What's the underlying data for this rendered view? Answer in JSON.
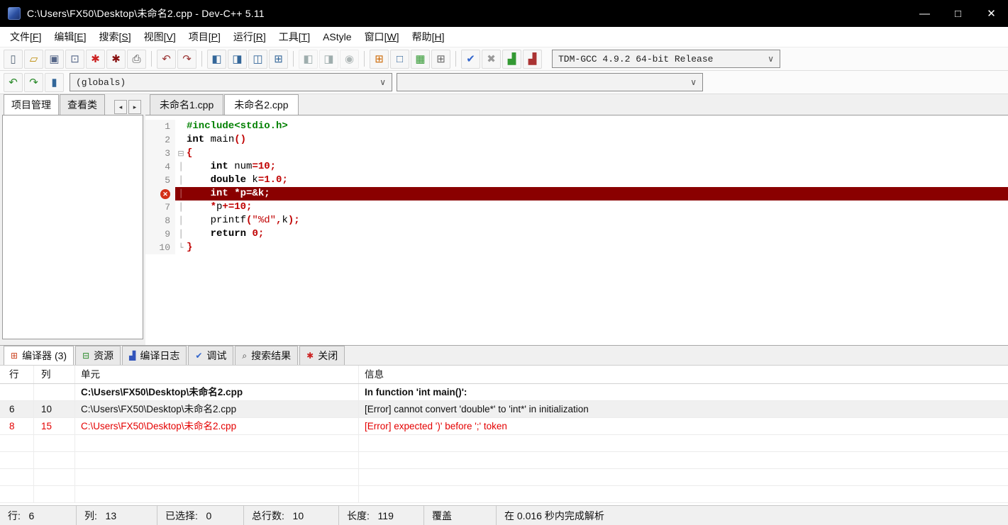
{
  "window": {
    "title": "C:\\Users\\FX50\\Desktop\\未命名2.cpp - Dev-C++ 5.11",
    "controls": {
      "minimize": "—",
      "maximize": "□",
      "close": "✕"
    }
  },
  "menu": {
    "items": [
      {
        "id": "file",
        "text": "文件",
        "key": "F"
      },
      {
        "id": "edit",
        "text": "编辑",
        "key": "E"
      },
      {
        "id": "search",
        "text": "搜索",
        "key": "S"
      },
      {
        "id": "view",
        "text": "视图",
        "key": "V"
      },
      {
        "id": "project",
        "text": "项目",
        "key": "P"
      },
      {
        "id": "run",
        "text": "运行",
        "key": "R"
      },
      {
        "id": "tools",
        "text": "工具",
        "key": "T"
      },
      {
        "id": "astyle",
        "text": "AStyle",
        "key": ""
      },
      {
        "id": "window",
        "text": "窗口",
        "key": "W"
      },
      {
        "id": "help",
        "text": "帮助",
        "key": "H"
      }
    ]
  },
  "toolbar": {
    "groups": [
      [
        {
          "name": "new-file-icon",
          "glyph": "▯",
          "color": "#556677"
        },
        {
          "name": "open-file-icon",
          "glyph": "▱",
          "color": "#bb8800"
        },
        {
          "name": "save-icon",
          "glyph": "▣",
          "color": "#556688"
        },
        {
          "name": "save-all-icon",
          "glyph": "⊡",
          "color": "#556688"
        },
        {
          "name": "close-file-icon",
          "glyph": "✱",
          "color": "#cc2222"
        },
        {
          "name": "close-all-icon",
          "glyph": "✱",
          "color": "#881111"
        },
        {
          "name": "print-icon",
          "glyph": "⎙",
          "color": "#444444"
        }
      ],
      [
        {
          "name": "undo-icon",
          "glyph": "↶",
          "color": "#993333"
        },
        {
          "name": "redo-icon",
          "glyph": "↷",
          "color": "#993333"
        }
      ],
      [
        {
          "name": "compile-icon",
          "glyph": "◧",
          "color": "#336699"
        },
        {
          "name": "run-icon",
          "glyph": "◨",
          "color": "#336699"
        },
        {
          "name": "compile-run-icon",
          "glyph": "◫",
          "color": "#336699"
        },
        {
          "name": "rebuild-all-icon",
          "glyph": "⊞",
          "color": "#336699"
        }
      ],
      [
        {
          "name": "debug-icon",
          "glyph": "◧",
          "color": "#2f4f4f",
          "disabled": true
        },
        {
          "name": "profile-icon",
          "glyph": "◨",
          "color": "#2f4f4f",
          "disabled": true
        },
        {
          "name": "stop-execution-icon",
          "glyph": "◉",
          "color": "#556666",
          "disabled": true
        }
      ],
      [
        {
          "name": "project-manager-toggle-icon",
          "glyph": "⊞",
          "color": "#cc6600"
        },
        {
          "name": "report-window-toggle-icon",
          "glyph": "□",
          "color": "#336699"
        },
        {
          "name": "window-layout-icon",
          "glyph": "▦",
          "color": "#339933"
        },
        {
          "name": "fullscreen-toggle-icon",
          "glyph": "⊞",
          "color": "#666666"
        }
      ],
      [
        {
          "name": "syntax-check-icon",
          "glyph": "✔",
          "color": "#3366cc"
        },
        {
          "name": "abort-icon",
          "glyph": "✖",
          "color": "#999999"
        },
        {
          "name": "profile-chart-icon",
          "glyph": "▟",
          "color": "#339933"
        },
        {
          "name": "delete-profiling-icon",
          "glyph": "▟",
          "color": "#aa3333"
        }
      ]
    ],
    "compiler_select": {
      "value": "TDM-GCC 4.9.2 64-bit Release"
    }
  },
  "toolbar2": {
    "buttons": [
      {
        "name": "nav-back-icon",
        "glyph": "↶",
        "color": "#2a8a2a"
      },
      {
        "name": "nav-forward-icon",
        "glyph": "↷",
        "color": "#2a8a2a"
      },
      {
        "name": "class-browser-icon",
        "glyph": "▮",
        "color": "#336699"
      }
    ],
    "globals_select": {
      "value": "(globals)"
    },
    "members_select": {
      "value": ""
    }
  },
  "left_panel": {
    "tabs": [
      {
        "id": "project-manager",
        "label": "项目管理",
        "active": true
      },
      {
        "id": "class-viewer",
        "label": "查看类",
        "active": false
      }
    ],
    "scroll_left": "◂",
    "scroll_right": "▸"
  },
  "editor": {
    "tabs": [
      {
        "id": "unnamed1",
        "label": "未命名1.cpp",
        "active": false
      },
      {
        "id": "unnamed2",
        "label": "未命名2.cpp",
        "active": true
      }
    ],
    "code_lines": [
      {
        "num": "1",
        "fold": "",
        "tokens": [
          [
            "pre",
            "#include<stdio.h>"
          ]
        ]
      },
      {
        "num": "2",
        "fold": "",
        "tokens": [
          [
            "kw",
            "int"
          ],
          [
            "pl",
            " main"
          ],
          [
            "sym",
            "()"
          ]
        ]
      },
      {
        "num": "3",
        "fold": "start",
        "tokens": [
          [
            "sym",
            "{"
          ]
        ]
      },
      {
        "num": "4",
        "fold": "mid",
        "tokens": [
          [
            "pl",
            "    "
          ],
          [
            "kw",
            "int"
          ],
          [
            "pl",
            " num"
          ],
          [
            "sym",
            "="
          ],
          [
            "num",
            "10"
          ],
          [
            "sym",
            ";"
          ]
        ]
      },
      {
        "num": "5",
        "fold": "mid",
        "tokens": [
          [
            "pl",
            "    "
          ],
          [
            "kw",
            "double"
          ],
          [
            "pl",
            " k"
          ],
          [
            "sym",
            "="
          ],
          [
            "num",
            "1.0"
          ],
          [
            "sym",
            ";"
          ]
        ]
      },
      {
        "num": "6",
        "fold": "mid",
        "error": true,
        "tokens": [
          [
            "pl",
            "    int *p=&k;"
          ]
        ]
      },
      {
        "num": "7",
        "fold": "mid",
        "tokens": [
          [
            "pl",
            "    "
          ],
          [
            "sym",
            "*"
          ],
          [
            "pl",
            "p"
          ],
          [
            "sym",
            "+="
          ],
          [
            "num",
            "10"
          ],
          [
            "sym",
            ";"
          ]
        ]
      },
      {
        "num": "8",
        "fold": "mid",
        "tokens": [
          [
            "pl",
            "    printf"
          ],
          [
            "sym",
            "("
          ],
          [
            "str",
            "\"%d\""
          ],
          [
            "sym",
            ","
          ],
          [
            "pl",
            "k"
          ],
          [
            "sym",
            ");"
          ]
        ]
      },
      {
        "num": "9",
        "fold": "mid",
        "tokens": [
          [
            "pl",
            "    "
          ],
          [
            "kw",
            "return"
          ],
          [
            "pl",
            " "
          ],
          [
            "num",
            "0"
          ],
          [
            "sym",
            ";"
          ]
        ]
      },
      {
        "num": "10",
        "fold": "end",
        "tokens": [
          [
            "sym",
            "}"
          ]
        ]
      }
    ],
    "error_marker": "✕"
  },
  "report": {
    "tabs": [
      {
        "id": "compiler",
        "label": "编译器 (3)",
        "icon": "compiler-grid-icon",
        "glyph": "⊞",
        "icon_color": "#cc4422",
        "active": true
      },
      {
        "id": "resource",
        "label": "资源",
        "icon": "resource-icon",
        "glyph": "⊟",
        "icon_color": "#2a8a2a",
        "active": false
      },
      {
        "id": "compile-log",
        "label": "编译日志",
        "icon": "chart-icon",
        "glyph": "▟",
        "icon_color": "#3355bb",
        "active": false
      },
      {
        "id": "debug",
        "label": "调试",
        "icon": "check-icon",
        "glyph": "✔",
        "icon_color": "#3366cc",
        "active": false
      },
      {
        "id": "search-results",
        "label": "搜索结果",
        "icon": "magnifier-icon",
        "glyph": "⌕",
        "icon_color": "#333333",
        "active": false
      },
      {
        "id": "close",
        "label": "关闭",
        "icon": "close-pinwheel-icon",
        "glyph": "✱",
        "icon_color": "#cc2222",
        "active": false
      }
    ],
    "columns": [
      "行",
      "列",
      "单元",
      "信息"
    ],
    "rows": [
      {
        "line": "",
        "col": "",
        "unit": "C:\\Users\\FX50\\Desktop\\未命名2.cpp",
        "message": "In function 'int main()':",
        "style": "bold"
      },
      {
        "line": "6",
        "col": "10",
        "unit": "C:\\Users\\FX50\\Desktop\\未命名2.cpp",
        "message": "[Error] cannot convert 'double*' to 'int*' in initialization",
        "style": "selected"
      },
      {
        "line": "8",
        "col": "15",
        "unit": "C:\\Users\\FX50\\Desktop\\未命名2.cpp",
        "message": "[Error] expected ')' before ';' token",
        "style": "error"
      }
    ]
  },
  "status_bar": {
    "segments": [
      "行:   6",
      "列:   13",
      "已选择:   0",
      "总行数:   10",
      "长度:   119",
      "覆盖",
      "在 0.016 秒内完成解析"
    ]
  }
}
